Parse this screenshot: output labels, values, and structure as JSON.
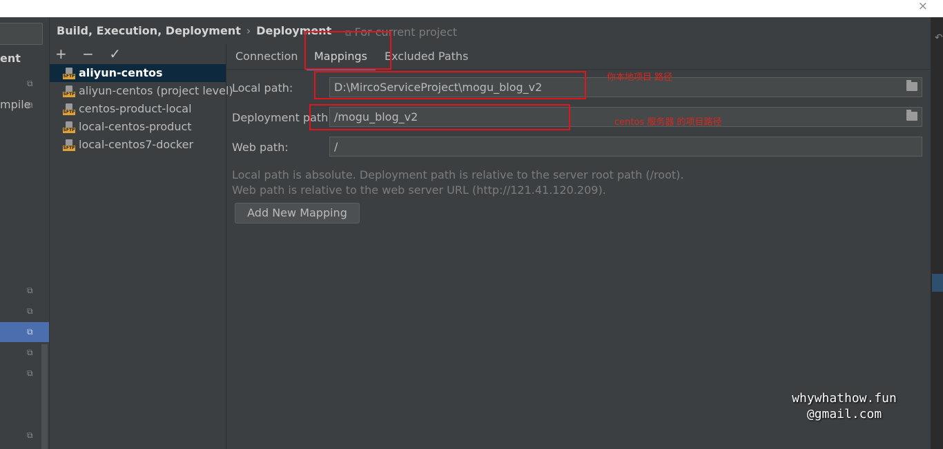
{
  "window": {
    "close_glyph": "×"
  },
  "left_strip": {
    "label_top": "ent",
    "label_compile": "mpile"
  },
  "header": {
    "crumb_parent": "Build, Execution, Deployment",
    "crumb_sep": "›",
    "crumb_current": "Deployment",
    "scope_note": "For current project"
  },
  "toolbar": {
    "add": "+",
    "remove": "−",
    "apply": "✓"
  },
  "servers": [
    {
      "name": "aliyun-centos"
    },
    {
      "name": "aliyun-centos (project level)"
    },
    {
      "name": "centos-product-local"
    },
    {
      "name": "local-centos-product"
    },
    {
      "name": "local-centos7-docker"
    }
  ],
  "tabs": {
    "connection": "Connection",
    "mappings": "Mappings",
    "excluded": "Excluded Paths"
  },
  "fields": {
    "local_label": "Local path:",
    "local_value": "D:\\MircoServiceProject\\mogu_blog_v2",
    "deploy_label": "Deployment path:",
    "deploy_value": "/mogu_blog_v2",
    "web_label": "Web path:",
    "web_value": "/"
  },
  "help": {
    "line1": "Local path is absolute. Deployment path is relative to the server root path (/root).",
    "line2": "Web path is relative to the web server URL (http://121.41.120.209)."
  },
  "buttons": {
    "add_mapping": "Add New Mapping"
  },
  "annotations": {
    "local_note": "你本地项目 路径",
    "deploy_note": "centos 服务器 的项目路径"
  },
  "watermark": {
    "line1": "whywhathow.fun",
    "line2": "@gmail.com"
  },
  "colors": {
    "accent": "#4b6eaf",
    "annotation": "#e0161c",
    "selection": "#0d293e"
  }
}
